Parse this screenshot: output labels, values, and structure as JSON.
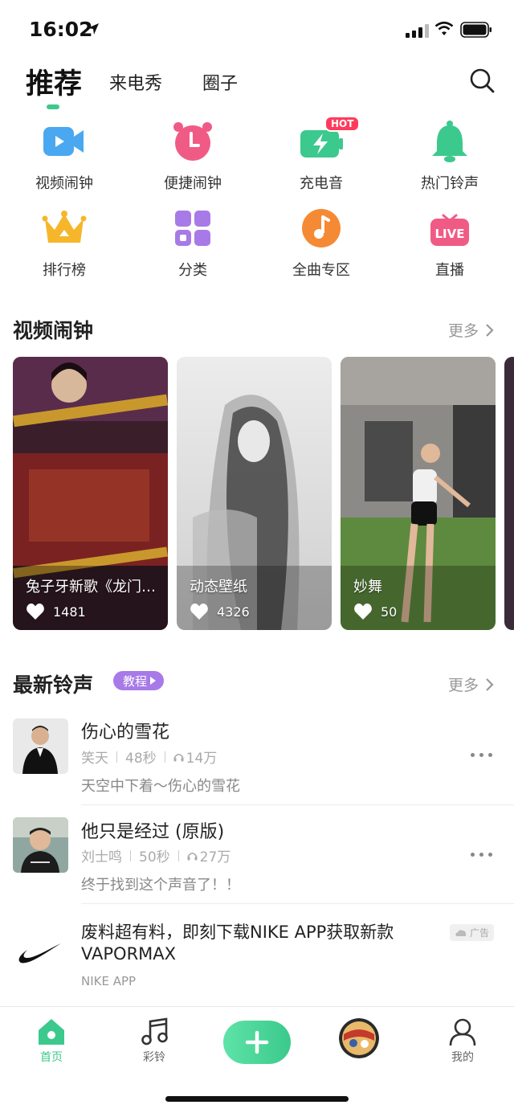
{
  "status": {
    "time": "16:02"
  },
  "tabs": [
    {
      "label": "推荐"
    },
    {
      "label": "来电秀"
    },
    {
      "label": "圈子"
    }
  ],
  "grid": [
    {
      "label": "视频闹钟",
      "icon": "video-camera-icon"
    },
    {
      "label": "便捷闹钟",
      "icon": "alarm-clock-icon"
    },
    {
      "label": "充电音",
      "icon": "battery-charge-icon",
      "badge": "HOT"
    },
    {
      "label": "热门铃声",
      "icon": "bell-icon"
    },
    {
      "label": "排行榜",
      "icon": "crown-icon"
    },
    {
      "label": "分类",
      "icon": "category-grid-icon"
    },
    {
      "label": "全曲专区",
      "icon": "music-note-icon"
    },
    {
      "label": "直播",
      "icon": "live-tv-icon",
      "icon_text": "LIVE"
    }
  ],
  "video_section": {
    "title": "视频闹钟",
    "more": "更多",
    "cards": [
      {
        "title": "兔子牙新歌《龙门客栈》",
        "likes": "1481"
      },
      {
        "title": "动态壁纸",
        "likes": "4326"
      },
      {
        "title": "妙舞",
        "likes": "50"
      }
    ]
  },
  "ringtone_section": {
    "title": "最新铃声",
    "badge": "教程",
    "more": "更多",
    "items": [
      {
        "title": "伤心的雪花",
        "artist": "笑天",
        "duration": "48秒",
        "plays": "14万",
        "desc": "天空中下着～伤心的雪花"
      },
      {
        "title": "他只是经过 (原版)",
        "artist": "刘士鸣",
        "duration": "50秒",
        "plays": "27万",
        "desc": "终于找到这个声音了！！"
      }
    ],
    "ad": {
      "title": "废料超有料，即刻下载NIKE APP获取新款VAPORMAX",
      "source": "NIKE APP",
      "badge": "广告"
    }
  },
  "bottom_nav": [
    {
      "label": "首页"
    },
    {
      "label": "彩铃"
    },
    {
      "label": ""
    },
    {
      "label": ""
    },
    {
      "label": "我的"
    }
  ],
  "colors": {
    "accent": "#3cc98d",
    "badge_purple": "#a77ae8",
    "hot_red": "#ff3b5c"
  }
}
